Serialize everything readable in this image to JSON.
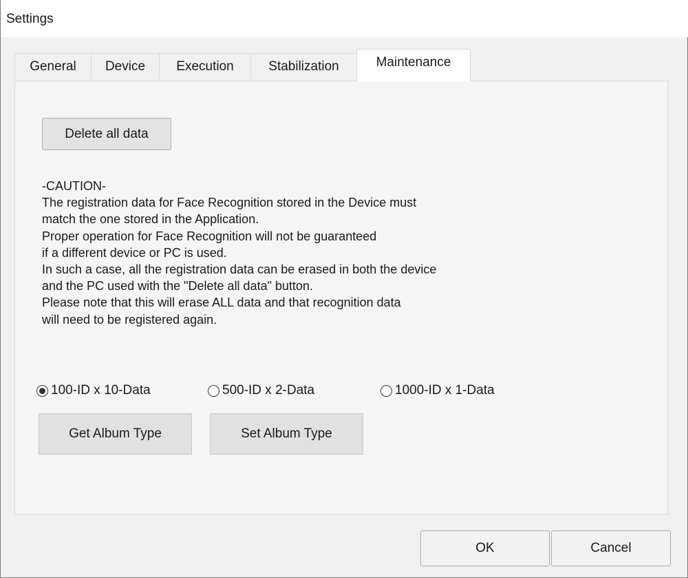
{
  "window": {
    "title": "Settings"
  },
  "tabs": [
    {
      "label": "General"
    },
    {
      "label": "Device"
    },
    {
      "label": "Execution"
    },
    {
      "label": "Stabilization"
    },
    {
      "label": "Maintenance",
      "active": true
    }
  ],
  "maintenance": {
    "delete_button": "Delete all data",
    "caution_lines": [
      "-CAUTION-",
      "The registration data for Face Recognition stored in the Device must",
      "match the one stored in the Application.",
      "Proper operation for Face Recognition will not be guaranteed",
      "if a different device or PC is used.",
      "In such a case, all the registration data can be erased in both the device",
      "and the PC used with the \"Delete all data\" button.",
      "Please note that this will erase ALL data and that recognition data",
      "will need to be registered again."
    ],
    "album_options": [
      {
        "label": "100-ID x 10-Data",
        "selected": true
      },
      {
        "label": "500-ID x 2-Data",
        "selected": false
      },
      {
        "label": "1000-ID x 1-Data",
        "selected": false
      }
    ],
    "get_album_button": "Get Album Type",
    "set_album_button": "Set Album Type"
  },
  "footer": {
    "ok_label": "OK",
    "cancel_label": "Cancel"
  },
  "colors": {
    "window_bg": "#f0f0f0",
    "panel_bg": "#f5f5f5",
    "button_bg": "#e1e1e1"
  }
}
